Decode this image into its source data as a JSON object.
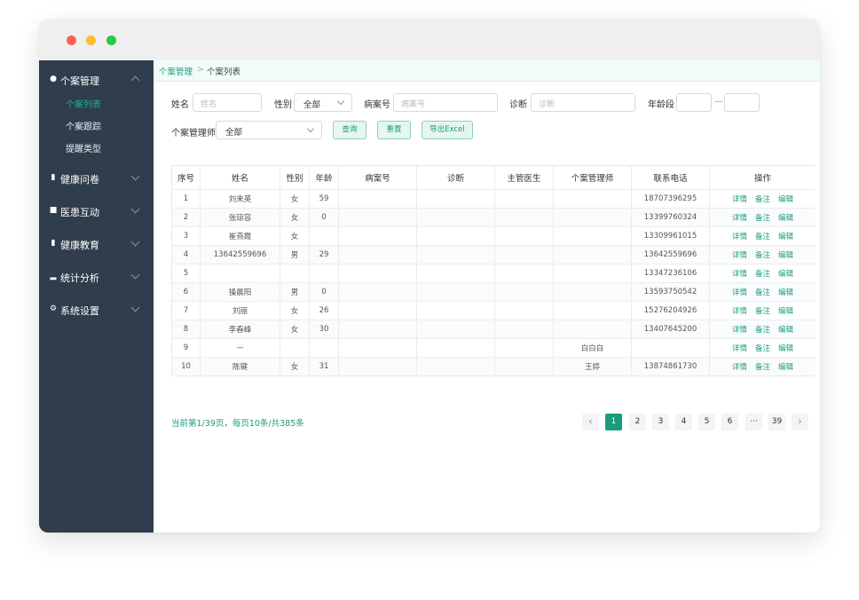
{
  "sidebar": {
    "groups": [
      {
        "icon": "user-icon",
        "label": "个案管理",
        "expanded": true
      },
      {
        "icon": "clipboard-icon",
        "label": "健康问卷"
      },
      {
        "icon": "chat-icon",
        "label": "医患互动"
      },
      {
        "icon": "book-icon",
        "label": "健康教育"
      },
      {
        "icon": "bar-chart-icon",
        "label": "统计分析"
      },
      {
        "icon": "gear-icon",
        "label": "系统设置"
      }
    ],
    "sub_items": [
      "个案列表",
      "个案跟踪",
      "提醒类型"
    ]
  },
  "breadcrumb": {
    "root": "个案管理",
    "separator": ">",
    "current": "个案列表"
  },
  "filters": {
    "name_label": "姓名",
    "name_placeholder": "姓名",
    "gender_label": "性别",
    "gender_value": "全部",
    "record_label": "病案号",
    "record_placeholder": "病案号",
    "diagnosis_label": "诊断",
    "diagnosis_placeholder": "诊断",
    "age_label": "年龄段",
    "age_sep": "—",
    "manager_label": "个案管理师",
    "manager_value": "全部"
  },
  "buttons": {
    "query": "查询",
    "reset": "重置",
    "export": "导出Excel"
  },
  "table": {
    "headers": [
      "序号",
      "姓名",
      "性别",
      "年龄",
      "病案号",
      "诊断",
      "主管医生",
      "个案管理师",
      "联系电话",
      "操作"
    ],
    "actions": [
      "详情",
      "备注",
      "编辑"
    ],
    "rows": [
      [
        "1",
        "刘来英",
        "女",
        "59",
        "",
        "",
        "",
        "",
        "18707396295"
      ],
      [
        "2",
        "张琼容",
        "女",
        "0",
        "",
        "",
        "",
        "",
        "13399760324"
      ],
      [
        "3",
        "崔燕霞",
        "女",
        "",
        "",
        "",
        "",
        "",
        "13309961015"
      ],
      [
        "4",
        "13642559696",
        "男",
        "29",
        "",
        "",
        "",
        "",
        "13642559696"
      ],
      [
        "5",
        "",
        "",
        "",
        "",
        "",
        "",
        "",
        "13347236106"
      ],
      [
        "6",
        "操晨阳",
        "男",
        "0",
        "",
        "",
        "",
        "",
        "13593750542"
      ],
      [
        "7",
        "刘丽",
        "女",
        "26",
        "",
        "",
        "",
        "",
        "15276204926"
      ],
      [
        "8",
        "李春峰",
        "女",
        "30",
        "",
        "",
        "",
        "",
        "13407645200"
      ],
      [
        "9",
        "—",
        "",
        "",
        "",
        "",
        "",
        "白白白",
        ""
      ],
      [
        "10",
        "陈键",
        "女",
        "31",
        "",
        "",
        "",
        "王婷",
        "13874861730"
      ]
    ]
  },
  "pagination": {
    "info": "当前第1/39页，每页10条/共385条",
    "prev": "‹",
    "next": "›",
    "pages": [
      "1",
      "2",
      "3",
      "4",
      "5",
      "6",
      "···",
      "39"
    ],
    "current": "1"
  }
}
